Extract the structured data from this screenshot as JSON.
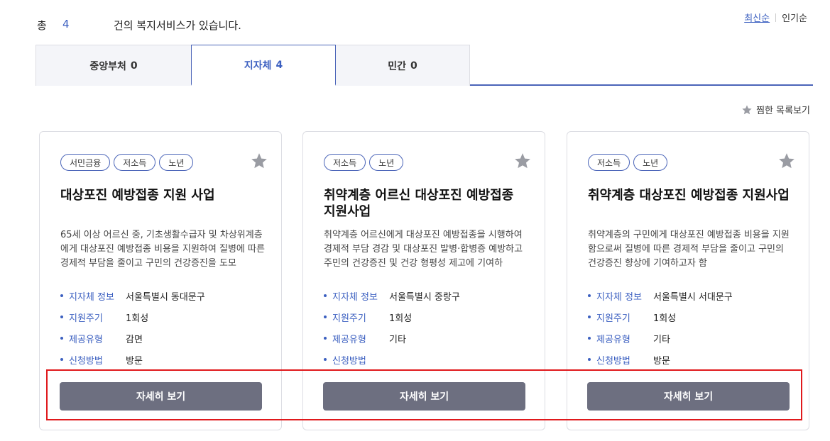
{
  "summary": {
    "lead": "총",
    "count": "4",
    "suffix": "건의 복지서비스가 있습니다."
  },
  "sort": {
    "latest": "최신순",
    "popular": "인기순"
  },
  "tabs": [
    {
      "label": "중앙부처",
      "count": "0"
    },
    {
      "label": "지자체",
      "count": "4"
    },
    {
      "label": "민간",
      "count": "0"
    }
  ],
  "favorites_link": "찜한 목록보기",
  "colors": {
    "accent": "#3b5fc0",
    "button": "#6d6f80",
    "highlight": "#e0191c"
  },
  "cards": [
    {
      "tags": [
        "서민금융",
        "저소득",
        "노년"
      ],
      "title": "대상포진 예방접종 지원 사업",
      "desc": "65세 이상 어르신 중, 기초생활수급자 및 차상위계층에게 대상포진 예방접종 비용을 지원하여 질병에 따른 경제적 부담을 줄이고 구민의 건강증진을 도모",
      "info": [
        {
          "label": "지자체 정보",
          "value": "서울특별시 동대문구"
        },
        {
          "label": "지원주기",
          "value": "1회성"
        },
        {
          "label": "제공유형",
          "value": "감면"
        },
        {
          "label": "신청방법",
          "value": "방문"
        }
      ],
      "button": "자세히 보기"
    },
    {
      "tags": [
        "저소득",
        "노년"
      ],
      "title": "취약계층 어르신 대상포진 예방접종 지원사업",
      "desc": "취약계층 어르신에게 대상포진 예방접종을 시행하여 경제적 부담 경감 및 대상포진 발병·합병증 예방하고 주민의 건강증진 및 건강 형평성 제고에 기여하",
      "info": [
        {
          "label": "지자체 정보",
          "value": "서울특별시 중랑구"
        },
        {
          "label": "지원주기",
          "value": "1회성"
        },
        {
          "label": "제공유형",
          "value": "기타"
        },
        {
          "label": "신청방법",
          "value": ""
        }
      ],
      "button": "자세히 보기"
    },
    {
      "tags": [
        "저소득",
        "노년"
      ],
      "title": "취약계층 대상포진 예방접종 지원사업",
      "desc": "취약계층의 구민에게 대상포진 예방접종 비용을 지원함으로써 질병에 따른 경제적 부담을 줄이고 구민의 건강증진 향상에 기여하고자 함",
      "info": [
        {
          "label": "지자체 정보",
          "value": "서울특별시 서대문구"
        },
        {
          "label": "지원주기",
          "value": "1회성"
        },
        {
          "label": "제공유형",
          "value": "기타"
        },
        {
          "label": "신청방법",
          "value": "방문"
        }
      ],
      "button": "자세히 보기"
    }
  ]
}
